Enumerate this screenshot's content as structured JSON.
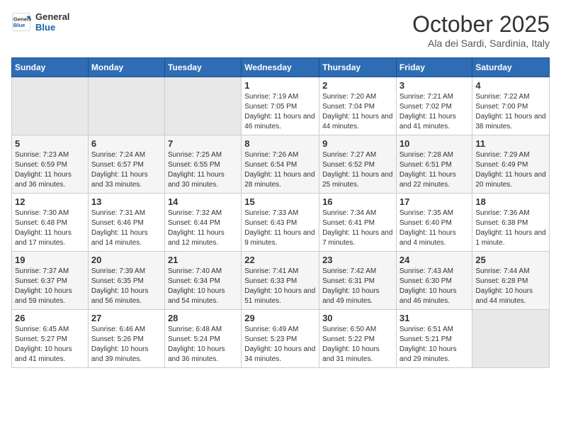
{
  "logo": {
    "line1": "General",
    "line2": "Blue"
  },
  "title": "October 2025",
  "subtitle": "Ala dei Sardi, Sardinia, Italy",
  "weekdays": [
    "Sunday",
    "Monday",
    "Tuesday",
    "Wednesday",
    "Thursday",
    "Friday",
    "Saturday"
  ],
  "weeks": [
    [
      {
        "day": "",
        "info": ""
      },
      {
        "day": "",
        "info": ""
      },
      {
        "day": "",
        "info": ""
      },
      {
        "day": "1",
        "info": "Sunrise: 7:19 AM\nSunset: 7:05 PM\nDaylight: 11 hours and 46 minutes."
      },
      {
        "day": "2",
        "info": "Sunrise: 7:20 AM\nSunset: 7:04 PM\nDaylight: 11 hours and 44 minutes."
      },
      {
        "day": "3",
        "info": "Sunrise: 7:21 AM\nSunset: 7:02 PM\nDaylight: 11 hours and 41 minutes."
      },
      {
        "day": "4",
        "info": "Sunrise: 7:22 AM\nSunset: 7:00 PM\nDaylight: 11 hours and 38 minutes."
      }
    ],
    [
      {
        "day": "5",
        "info": "Sunrise: 7:23 AM\nSunset: 6:59 PM\nDaylight: 11 hours and 36 minutes."
      },
      {
        "day": "6",
        "info": "Sunrise: 7:24 AM\nSunset: 6:57 PM\nDaylight: 11 hours and 33 minutes."
      },
      {
        "day": "7",
        "info": "Sunrise: 7:25 AM\nSunset: 6:55 PM\nDaylight: 11 hours and 30 minutes."
      },
      {
        "day": "8",
        "info": "Sunrise: 7:26 AM\nSunset: 6:54 PM\nDaylight: 11 hours and 28 minutes."
      },
      {
        "day": "9",
        "info": "Sunrise: 7:27 AM\nSunset: 6:52 PM\nDaylight: 11 hours and 25 minutes."
      },
      {
        "day": "10",
        "info": "Sunrise: 7:28 AM\nSunset: 6:51 PM\nDaylight: 11 hours and 22 minutes."
      },
      {
        "day": "11",
        "info": "Sunrise: 7:29 AM\nSunset: 6:49 PM\nDaylight: 11 hours and 20 minutes."
      }
    ],
    [
      {
        "day": "12",
        "info": "Sunrise: 7:30 AM\nSunset: 6:48 PM\nDaylight: 11 hours and 17 minutes."
      },
      {
        "day": "13",
        "info": "Sunrise: 7:31 AM\nSunset: 6:46 PM\nDaylight: 11 hours and 14 minutes."
      },
      {
        "day": "14",
        "info": "Sunrise: 7:32 AM\nSunset: 6:44 PM\nDaylight: 11 hours and 12 minutes."
      },
      {
        "day": "15",
        "info": "Sunrise: 7:33 AM\nSunset: 6:43 PM\nDaylight: 11 hours and 9 minutes."
      },
      {
        "day": "16",
        "info": "Sunrise: 7:34 AM\nSunset: 6:41 PM\nDaylight: 11 hours and 7 minutes."
      },
      {
        "day": "17",
        "info": "Sunrise: 7:35 AM\nSunset: 6:40 PM\nDaylight: 11 hours and 4 minutes."
      },
      {
        "day": "18",
        "info": "Sunrise: 7:36 AM\nSunset: 6:38 PM\nDaylight: 11 hours and 1 minute."
      }
    ],
    [
      {
        "day": "19",
        "info": "Sunrise: 7:37 AM\nSunset: 6:37 PM\nDaylight: 10 hours and 59 minutes."
      },
      {
        "day": "20",
        "info": "Sunrise: 7:39 AM\nSunset: 6:35 PM\nDaylight: 10 hours and 56 minutes."
      },
      {
        "day": "21",
        "info": "Sunrise: 7:40 AM\nSunset: 6:34 PM\nDaylight: 10 hours and 54 minutes."
      },
      {
        "day": "22",
        "info": "Sunrise: 7:41 AM\nSunset: 6:33 PM\nDaylight: 10 hours and 51 minutes."
      },
      {
        "day": "23",
        "info": "Sunrise: 7:42 AM\nSunset: 6:31 PM\nDaylight: 10 hours and 49 minutes."
      },
      {
        "day": "24",
        "info": "Sunrise: 7:43 AM\nSunset: 6:30 PM\nDaylight: 10 hours and 46 minutes."
      },
      {
        "day": "25",
        "info": "Sunrise: 7:44 AM\nSunset: 6:28 PM\nDaylight: 10 hours and 44 minutes."
      }
    ],
    [
      {
        "day": "26",
        "info": "Sunrise: 6:45 AM\nSunset: 5:27 PM\nDaylight: 10 hours and 41 minutes."
      },
      {
        "day": "27",
        "info": "Sunrise: 6:46 AM\nSunset: 5:26 PM\nDaylight: 10 hours and 39 minutes."
      },
      {
        "day": "28",
        "info": "Sunrise: 6:48 AM\nSunset: 5:24 PM\nDaylight: 10 hours and 36 minutes."
      },
      {
        "day": "29",
        "info": "Sunrise: 6:49 AM\nSunset: 5:23 PM\nDaylight: 10 hours and 34 minutes."
      },
      {
        "day": "30",
        "info": "Sunrise: 6:50 AM\nSunset: 5:22 PM\nDaylight: 10 hours and 31 minutes."
      },
      {
        "day": "31",
        "info": "Sunrise: 6:51 AM\nSunset: 5:21 PM\nDaylight: 10 hours and 29 minutes."
      },
      {
        "day": "",
        "info": ""
      }
    ]
  ]
}
